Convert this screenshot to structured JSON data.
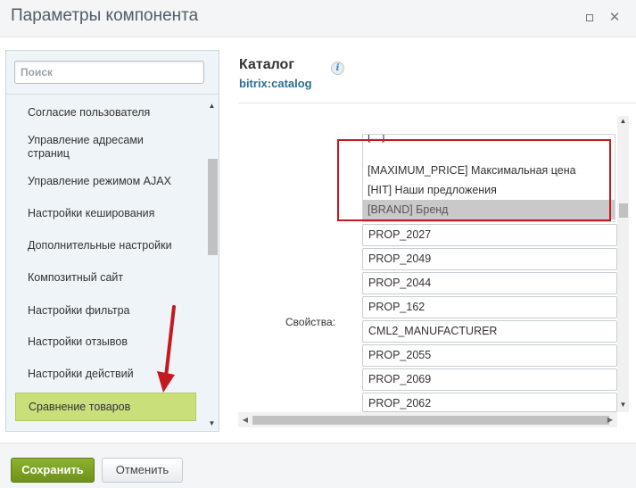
{
  "window": {
    "title": "Параметры компонента",
    "minimize_icon": "square-icon",
    "close_icon": "close-icon"
  },
  "sidebar": {
    "search_placeholder": "Поиск",
    "items": [
      {
        "label": "Согласие пользователя"
      },
      {
        "label": "Управление адресами страниц"
      },
      {
        "label": "Управление режимом AJAX"
      },
      {
        "label": "Настройки кеширования"
      },
      {
        "label": "Дополнительные настройки"
      },
      {
        "label": "Композитный сайт"
      },
      {
        "label": "Настройки фильтра"
      },
      {
        "label": "Настройки отзывов"
      },
      {
        "label": "Настройки действий"
      },
      {
        "label": "Сравнение товаров",
        "active": true
      }
    ],
    "active_color": "#c8df7a"
  },
  "component": {
    "title": "Каталог",
    "code": "bitrix:catalog",
    "info_icon": "info-icon"
  },
  "properties": {
    "label": "Свойства:",
    "listbox_options": [
      {
        "label": "[MAXIMUM_PRICE] Максимальная цена",
        "selected": false
      },
      {
        "label": "[HIT] Наши предложения",
        "selected": false
      },
      {
        "label": "[BRAND] Бренд",
        "selected": true
      }
    ],
    "fields": [
      "PROP_2027",
      "PROP_2049",
      "PROP_2044",
      "PROP_162",
      "CML2_MANUFACTURER",
      "PROP_2055",
      "PROP_2069",
      "PROP_2062"
    ]
  },
  "annotation": {
    "highlight_color": "#c4191f",
    "arrow_color": "#c4191f"
  },
  "footer": {
    "save_label": "Сохранить",
    "cancel_label": "Отменить",
    "save_color": "#7ea324"
  }
}
